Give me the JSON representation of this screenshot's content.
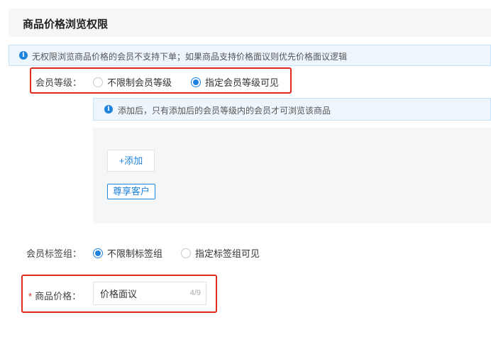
{
  "section": {
    "title": "商品价格浏览权限"
  },
  "notice": {
    "text": "无权限浏览商品价格的会员不支持下单；如果商品支持价格面议则优先价格面议逻辑"
  },
  "member_level": {
    "label": "会员等级：",
    "options": [
      {
        "label": "不限制会员等级",
        "checked": false
      },
      {
        "label": "指定会员等级可见",
        "checked": true
      }
    ],
    "hint": "添加后，只有添加后的会员等级内的会员才可浏览该商品",
    "add_button": "+添加",
    "tags": [
      "尊享客户"
    ]
  },
  "member_tag_group": {
    "label": "会员标签组：",
    "options": [
      {
        "label": "不限制标签组",
        "checked": true
      },
      {
        "label": "指定标签组可见",
        "checked": false
      }
    ]
  },
  "price": {
    "required_mark": "*",
    "label": "商品价格：",
    "value": "价格面议",
    "count": "4/9"
  },
  "colors": {
    "accent": "#1f82dd",
    "highlight": "#e02a1f",
    "panel": "#f5f6f8"
  }
}
